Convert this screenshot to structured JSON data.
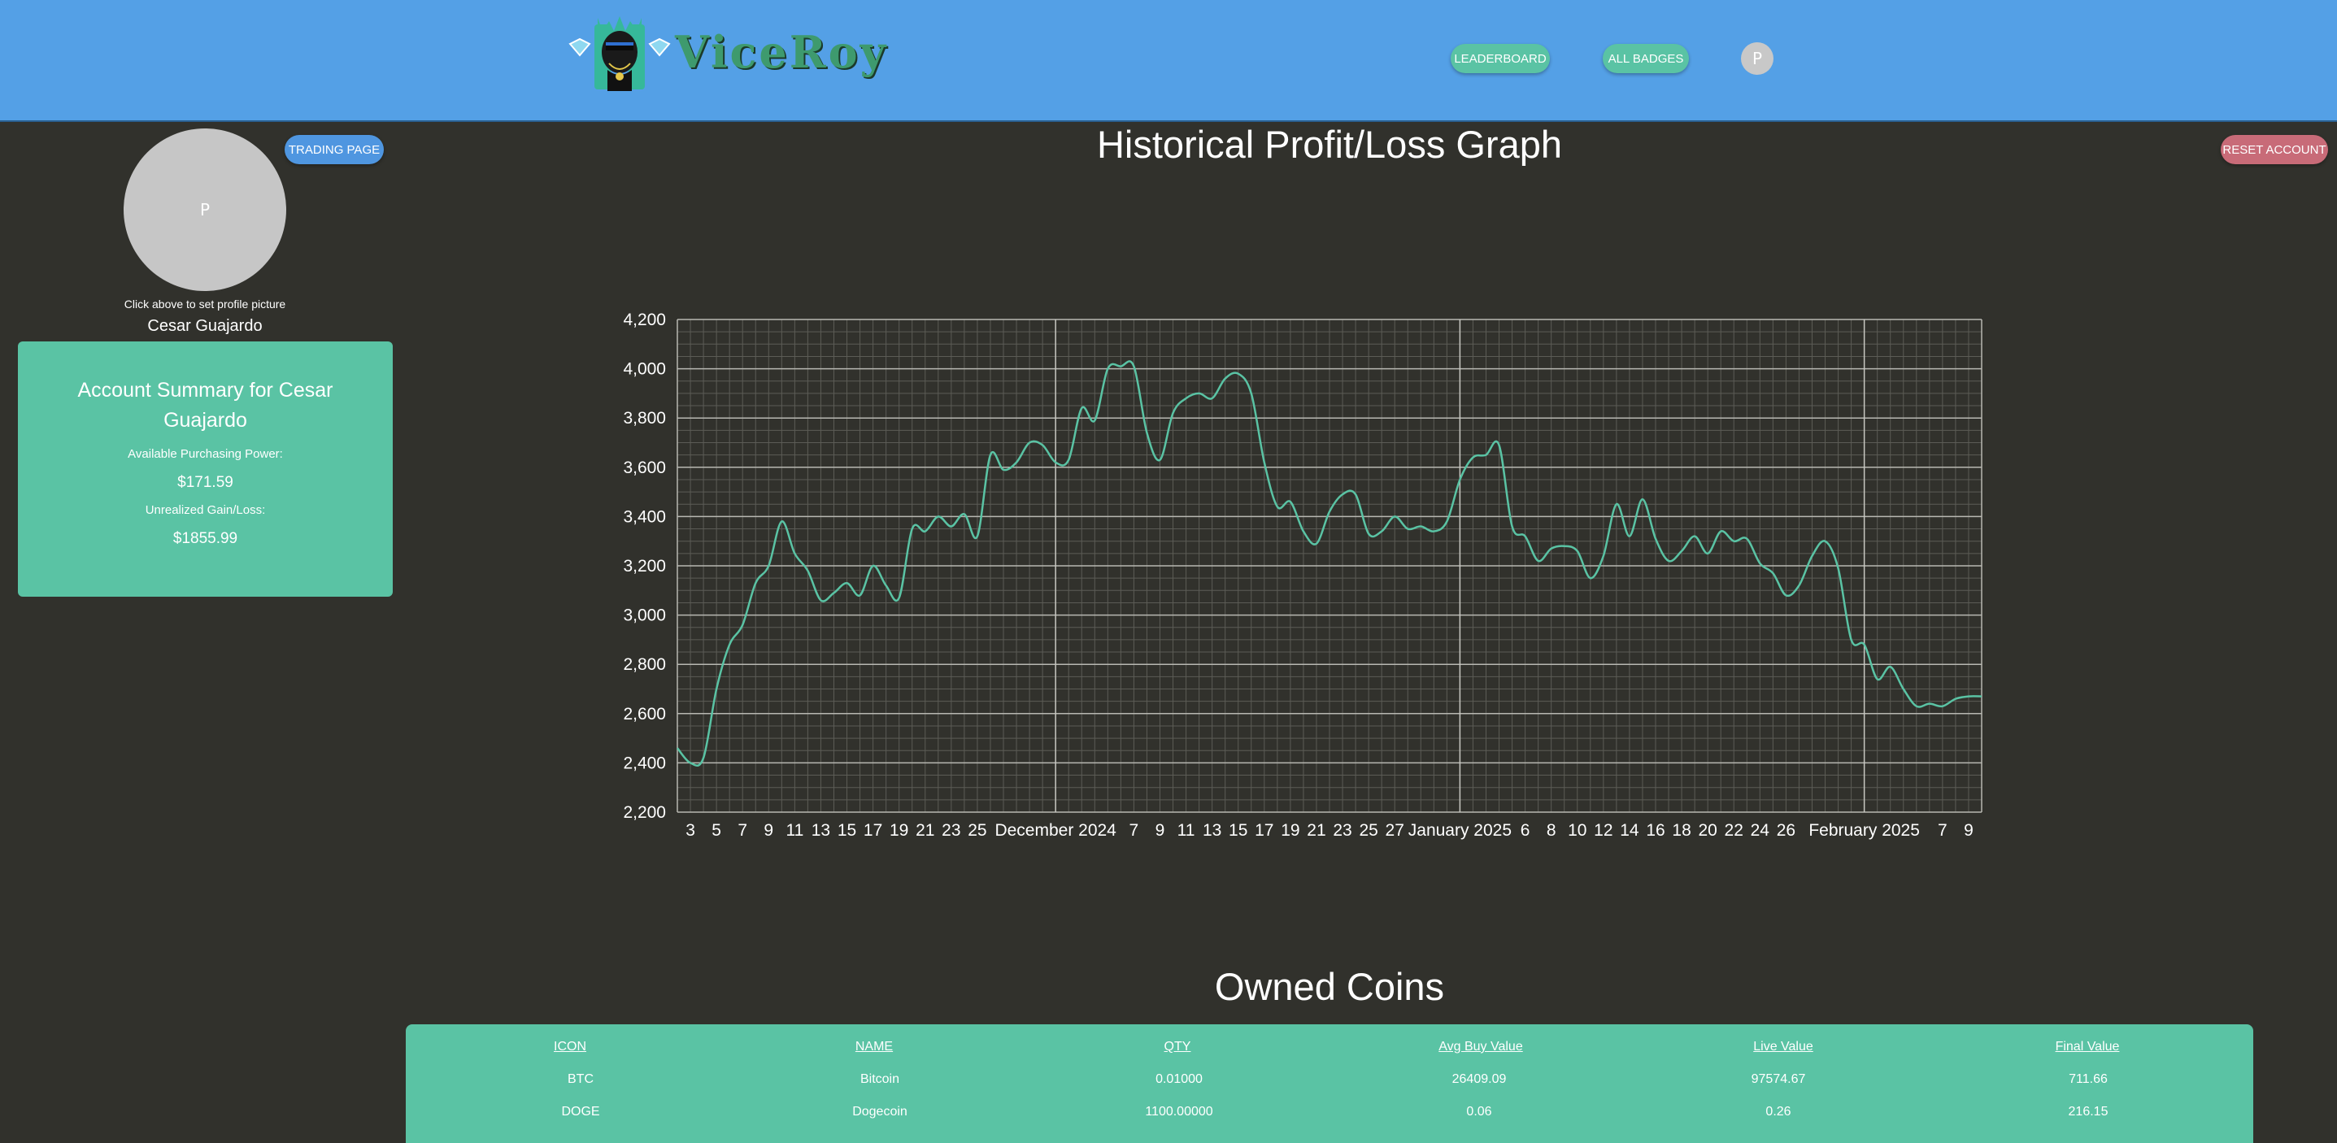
{
  "header": {
    "brand": "ViceRoy",
    "leaderboard_label": "LEADERBOARD",
    "all_badges_label": "ALL BADGES",
    "avatar_initial": "P"
  },
  "sidebar": {
    "trading_page_label": "TRADING PAGE",
    "avatar_initial": "P",
    "hint": "Click above to set profile picture",
    "username": "Cesar Guajardo",
    "summary": {
      "title": "Account Summary for Cesar Guajardo",
      "purchasing_power_label": "Available Purchasing Power:",
      "purchasing_power": "$171.59",
      "unrealized_label": "Unrealized Gain/Loss:",
      "unrealized": "$1855.99"
    }
  },
  "reset_label": "RESET ACCOUNT",
  "graph_title": "Historical Profit/Loss Graph",
  "coins_title": "Owned Coins",
  "table": {
    "headers": [
      "ICON",
      "NAME",
      "QTY",
      "Avg Buy Value",
      "Live Value",
      "Final Value"
    ],
    "rows": [
      [
        "BTC",
        "Bitcoin",
        "0.01000",
        "26409.09",
        "97574.67",
        "711.66"
      ],
      [
        "DOGE",
        "Dogecoin",
        "1100.00000",
        "0.06",
        "0.26",
        "216.15"
      ]
    ]
  },
  "colors": {
    "header": "#54a0e6",
    "accent_green": "#5ac3a4",
    "accent_blue": "#4f96e0",
    "accent_red": "#c86b78",
    "background": "#31312c",
    "line": "#5ac3a4"
  },
  "chart_data": {
    "type": "line",
    "title": "Historical Profit/Loss Graph",
    "ylim": [
      2200,
      4200
    ],
    "yticks": [
      2200,
      2400,
      2600,
      2800,
      3000,
      3200,
      3400,
      3600,
      3800,
      4000,
      4200
    ],
    "grid": true,
    "x_tick_labels": [
      "3",
      "5",
      "7",
      "9",
      "11",
      "13",
      "15",
      "17",
      "19",
      "21",
      "23",
      "25",
      "December 2024",
      "7",
      "9",
      "11",
      "13",
      "15",
      "17",
      "19",
      "21",
      "23",
      "25",
      "27",
      "January 2025",
      "6",
      "8",
      "10",
      "12",
      "14",
      "16",
      "18",
      "20",
      "22",
      "24",
      "26",
      "February 2025",
      "7",
      "9"
    ],
    "series": [
      {
        "x": [
          "2024-11-02",
          "2024-11-03",
          "2024-11-04",
          "2024-11-05",
          "2024-11-06",
          "2024-11-07",
          "2024-11-08",
          "2024-11-09",
          "2024-11-10",
          "2024-11-11",
          "2024-11-12",
          "2024-11-13",
          "2024-11-14",
          "2024-11-15",
          "2024-11-16",
          "2024-11-17",
          "2024-11-18",
          "2024-11-19",
          "2024-11-20",
          "2024-11-21",
          "2024-11-22",
          "2024-11-23",
          "2024-11-24",
          "2024-11-25",
          "2024-11-26",
          "2024-11-27",
          "2024-11-28",
          "2024-11-29",
          "2024-11-30",
          "2024-12-01",
          "2024-12-02",
          "2024-12-03",
          "2024-12-04",
          "2024-12-05",
          "2024-12-06",
          "2024-12-07",
          "2024-12-08",
          "2024-12-09",
          "2024-12-10",
          "2024-12-11",
          "2024-12-12",
          "2024-12-13",
          "2024-12-14",
          "2024-12-15",
          "2024-12-16",
          "2024-12-17",
          "2024-12-18",
          "2024-12-19",
          "2024-12-20",
          "2024-12-21",
          "2024-12-22",
          "2024-12-23",
          "2024-12-24",
          "2024-12-25",
          "2024-12-26",
          "2024-12-27",
          "2024-12-28",
          "2024-12-29",
          "2024-12-30",
          "2024-12-31",
          "2025-01-01",
          "2025-01-02",
          "2025-01-03",
          "2025-01-04",
          "2025-01-05",
          "2025-01-06",
          "2025-01-07",
          "2025-01-08",
          "2025-01-09",
          "2025-01-10",
          "2025-01-11",
          "2025-01-12",
          "2025-01-13",
          "2025-01-14",
          "2025-01-15",
          "2025-01-16",
          "2025-01-17",
          "2025-01-18",
          "2025-01-19",
          "2025-01-20",
          "2025-01-21",
          "2025-01-22",
          "2025-01-23",
          "2025-01-24",
          "2025-01-25",
          "2025-01-26",
          "2025-01-27",
          "2025-01-28",
          "2025-01-29",
          "2025-01-30",
          "2025-01-31",
          "2025-02-01",
          "2025-02-02",
          "2025-02-03",
          "2025-02-04",
          "2025-02-05",
          "2025-02-06",
          "2025-02-07",
          "2025-02-08",
          "2025-02-09",
          "2025-02-10"
        ],
        "y": [
          2460,
          2400,
          2420,
          2700,
          2880,
          2960,
          3130,
          3200,
          3380,
          3250,
          3180,
          3060,
          3090,
          3130,
          3080,
          3200,
          3120,
          3070,
          3350,
          3340,
          3400,
          3360,
          3410,
          3320,
          3650,
          3590,
          3620,
          3700,
          3690,
          3620,
          3630,
          3840,
          3790,
          4000,
          4010,
          4010,
          3740,
          3630,
          3820,
          3880,
          3900,
          3880,
          3960,
          3980,
          3900,
          3620,
          3440,
          3460,
          3340,
          3290,
          3420,
          3490,
          3490,
          3330,
          3340,
          3400,
          3350,
          3360,
          3340,
          3380,
          3550,
          3640,
          3650,
          3690,
          3360,
          3320,
          3220,
          3270,
          3280,
          3260,
          3150,
          3240,
          3450,
          3320,
          3470,
          3310,
          3220,
          3260,
          3320,
          3250,
          3340,
          3300,
          3310,
          3210,
          3170,
          3080,
          3120,
          3240,
          3300,
          3190,
          2900,
          2880,
          2740,
          2790,
          2700,
          2630,
          2640,
          2630,
          2660,
          2670,
          2670
        ]
      }
    ]
  }
}
